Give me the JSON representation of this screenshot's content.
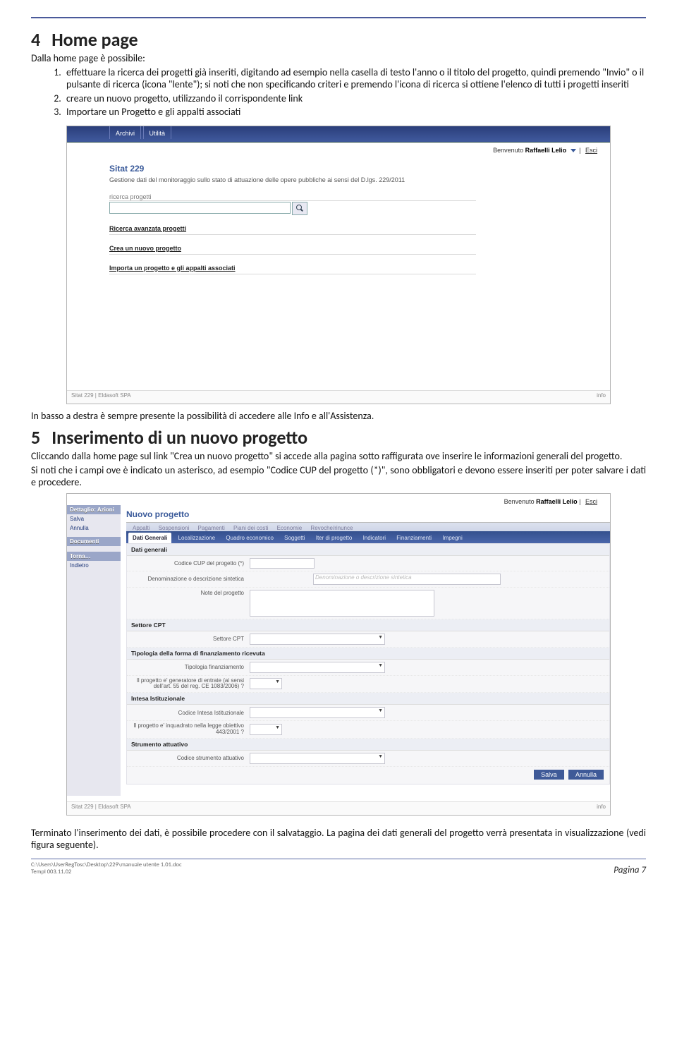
{
  "sec4": {
    "heading_num": "4",
    "heading": "Home page",
    "intro": "Dalla home page è possibile:",
    "items": [
      "effettuare la ricerca dei progetti già inseriti, digitando ad esempio nella casella di testo l'anno o il titolo del progetto, quindi premendo \"Invio\" o il pulsante di ricerca (icona \"lente\"); si noti che non specificando criteri e premendo l'icona di ricerca si ottiene l'elenco di tutti i progetti inseriti",
      "creare un nuovo progetto, utilizzando il corrispondente link",
      "Importare un Progetto e gli appalti associati"
    ],
    "after": "In basso a destra è sempre presente la possibilità di accedere alle Info e all'Assistenza."
  },
  "shot1": {
    "tabs": [
      "Archivi",
      "Utilità"
    ],
    "welcome_pre": "Benvenuto ",
    "welcome_user": "Raffaelli Lelio",
    "exit": "Esci",
    "apptitle": "Sitat 229",
    "appsub": "Gestione dati del monitoraggio sullo stato di attuazione delle opere pubbliche ai sensi del D.lgs. 229/2011",
    "searchlabel": "ricerca progetti",
    "link_adv": "Ricerca avanzata progetti",
    "link_new": "Crea un nuovo progetto",
    "link_import": "Importa un progetto e gli appalti associati",
    "footerleft": "Sitat 229  | Eldasoft SPA",
    "footerright": "info"
  },
  "sec5": {
    "heading_num": "5",
    "heading": "Inserimento di un nuovo progetto",
    "p1": "Cliccando dalla home page sul link \"Crea un nuovo progetto\" si accede alla pagina sotto raffigurata ove inserire le informazioni generali del progetto.",
    "p2": "Si noti che i campi ove è indicato un asterisco, ad esempio \"Codice CUP del progetto (*)\", sono obbligatori e devono essere inseriti per poter salvare i dati e procedere.",
    "after": "Terminato l'inserimento dei dati, è possibile procedere con il salvataggio. La pagina dei dati generali del progetto verrà presentata in visualizzazione (vedi figura seguente)."
  },
  "shot2": {
    "welcome_pre": "Benvenuto ",
    "welcome_user": "Raffaelli Lelio",
    "exit": "Esci",
    "side": {
      "hdr1": "Dettaglio: Azioni",
      "salva": "Salva",
      "annulla": "Annulla",
      "hdr2": "Documenti",
      "hdr3": "Torna…",
      "indietro": "Indietro"
    },
    "title": "Nuovo progetto",
    "tabs_upper": [
      "Appalti",
      "Sospensioni",
      "Pagamenti",
      "Piani dei costi",
      "Economie",
      "Revoche/rinunce"
    ],
    "tabs_lower_active": "Dati Generali",
    "tabs_lower_rest": [
      "Localizzazione",
      "Quadro economico",
      "Soggetti",
      "Iter di progetto",
      "Indicatori",
      "Finanziamenti",
      "Impegni"
    ],
    "sect_generali": "Dati generali",
    "f_cup": "Codice CUP del progetto (*)",
    "f_denom": "Denominazione o descrizione sintetica",
    "f_denom_ph": "Denominazione o descrizione sintetica",
    "f_note": "Note del progetto",
    "sect_cpt": "Settore CPT",
    "f_cpt": "Settore CPT",
    "sect_tipfin": "Tipologia della forma di finanziamento ricevuta",
    "f_tipfin": "Tipologia finanziamento",
    "f_genentrate": "Il progetto e' generatore di entrate (ai sensi dell'art. 55 del reg. CE 1083/2006) ?",
    "sect_intesa": "Intesa Istituzionale",
    "f_codintesa": "Codice Intesa Istituzionale",
    "f_inquadr": "Il progetto e' inquadrato nella legge obiettivo 443/2001 ?",
    "sect_strum": "Strumento attuativo",
    "f_codstrum": "Codice strumento attuativo",
    "btn_salva": "Salva",
    "btn_annulla": "Annulla",
    "footerleft": "Sitat 229  | Eldasoft SPA",
    "footerright": "info"
  },
  "footer": {
    "path": "C:\\Users\\UserRegTosc\\Desktop\\229\\manuale utente 1.01.doc",
    "ver": "Templ 003.11.02",
    "page": "Pagina 7"
  }
}
